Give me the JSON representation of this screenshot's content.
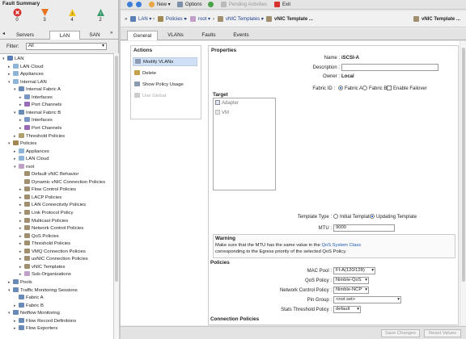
{
  "fault_summary": {
    "title": "Fault Summary",
    "items": [
      {
        "count": "0",
        "icon": "critical-x-icon",
        "color": "#d9302c"
      },
      {
        "count": "3",
        "icon": "major-triangle-icon",
        "color": "#e8731e"
      },
      {
        "count": "4",
        "icon": "minor-triangle-icon",
        "color": "#f2c21b"
      },
      {
        "count": "2",
        "icon": "warning-triangle-icon",
        "color": "#3a9c6a"
      }
    ]
  },
  "left_tabs": [
    "Servers",
    "LAN",
    "SAN"
  ],
  "left_tabs_active": "LAN",
  "filter": {
    "label": "Filter:",
    "value": "All"
  },
  "tree": [
    {
      "label": "LAN",
      "depth": 0,
      "exp": "▾",
      "icon": "#5a7fb5"
    },
    {
      "label": "LAN Cloud",
      "depth": 1,
      "exp": "▸",
      "icon": "#8fb4d9"
    },
    {
      "label": "Appliances",
      "depth": 1,
      "exp": "▸",
      "icon": "#8fb4d9"
    },
    {
      "label": "Internal LAN",
      "depth": 1,
      "exp": "▾",
      "icon": "#8fb4d9"
    },
    {
      "label": "Internal Fabric A",
      "depth": 2,
      "exp": "▾",
      "icon": "#6a8ab8"
    },
    {
      "label": "Interfaces",
      "depth": 3,
      "exp": "▸",
      "icon": "#7a96c4"
    },
    {
      "label": "Port Channels",
      "depth": 3,
      "exp": "▸",
      "icon": "#9a6ab8"
    },
    {
      "label": "Internal Fabric B",
      "depth": 2,
      "exp": "▾",
      "icon": "#6a8ab8"
    },
    {
      "label": "Interfaces",
      "depth": 3,
      "exp": "▸",
      "icon": "#7a96c4"
    },
    {
      "label": "Port Channels",
      "depth": 3,
      "exp": "▸",
      "icon": "#9a6ab8"
    },
    {
      "label": "Threshold Policies",
      "depth": 2,
      "exp": "▸",
      "icon": "#b0a070"
    },
    {
      "label": "Policies",
      "depth": 1,
      "exp": "▾",
      "icon": "#a08850"
    },
    {
      "label": "Appliances",
      "depth": 2,
      "exp": "▸",
      "icon": "#8fb4d9"
    },
    {
      "label": "LAN Cloud",
      "depth": 2,
      "exp": "▸",
      "icon": "#8fb4d9"
    },
    {
      "label": "root",
      "depth": 2,
      "exp": "▾",
      "icon": "#c0a0c8"
    },
    {
      "label": "Default vNIC Behavior",
      "depth": 3,
      "exp": "",
      "icon": "#a09070"
    },
    {
      "label": "Dynamic vNIC Connection Policies",
      "depth": 3,
      "exp": "",
      "icon": "#a09070"
    },
    {
      "label": "Flow Control Policies",
      "depth": 3,
      "exp": "▸",
      "icon": "#a09070"
    },
    {
      "label": "LACP Policies",
      "depth": 3,
      "exp": "▸",
      "icon": "#a09070"
    },
    {
      "label": "LAN Connectivity Policies",
      "depth": 3,
      "exp": "▸",
      "icon": "#a09070"
    },
    {
      "label": "Link Protocol Policy",
      "depth": 3,
      "exp": "▸",
      "icon": "#a09070"
    },
    {
      "label": "Multicast Policies",
      "depth": 3,
      "exp": "▸",
      "icon": "#a09070"
    },
    {
      "label": "Network Control Policies",
      "depth": 3,
      "exp": "▸",
      "icon": "#a09070"
    },
    {
      "label": "QoS Policies",
      "depth": 3,
      "exp": "▸",
      "icon": "#a09070"
    },
    {
      "label": "Threshold Policies",
      "depth": 3,
      "exp": "▸",
      "icon": "#a09070"
    },
    {
      "label": "VMQ Connection Policies",
      "depth": 3,
      "exp": "▸",
      "icon": "#a09070"
    },
    {
      "label": "usNIC Connection Policies",
      "depth": 3,
      "exp": "▸",
      "icon": "#a09070"
    },
    {
      "label": "vNIC Templates",
      "depth": 3,
      "exp": "▸",
      "icon": "#a09070"
    },
    {
      "label": "Sub-Organizations",
      "depth": 3,
      "exp": "▸",
      "icon": "#c0a0c8"
    },
    {
      "label": "Pools",
      "depth": 1,
      "exp": "▸",
      "icon": "#6a8ab8"
    },
    {
      "label": "Traffic Monitoring Sessions",
      "depth": 1,
      "exp": "▾",
      "icon": "#6a8ab8"
    },
    {
      "label": "Fabric A",
      "depth": 2,
      "exp": "",
      "icon": "#6a8ab8"
    },
    {
      "label": "Fabric B",
      "depth": 2,
      "exp": "▸",
      "icon": "#6a8ab8"
    },
    {
      "label": "Netflow Monitoring",
      "depth": 1,
      "exp": "▾",
      "icon": "#6a8ab8"
    },
    {
      "label": "Flow Record Definitions",
      "depth": 2,
      "exp": "▸",
      "icon": "#6a8ab8"
    },
    {
      "label": "Flow Exporters",
      "depth": 2,
      "exp": "▸",
      "icon": "#6a8ab8"
    }
  ],
  "toolbar": {
    "new": "New ▾",
    "options": "Options",
    "pending": "Pending Activities",
    "exit": "Exit"
  },
  "breadcrumb": {
    "lan": "LAN ▾",
    "policies": "Policies ▾",
    "root": "root ▾",
    "vnic_templates": "vNIC Templates ▾",
    "current": "vNIC Template ...",
    "title_right": "vNIC Template ..."
  },
  "main_tabs": [
    "General",
    "VLANs",
    "Faults",
    "Events"
  ],
  "actions": {
    "title": "Actions",
    "items": [
      "Modify VLANs",
      "Delete",
      "Show Policy Usage",
      "Use Global"
    ]
  },
  "properties": {
    "title": "Properties",
    "name_label": "Name :",
    "name_value": "iSCSI-A",
    "description_label": "Description :",
    "description_value": "",
    "owner_label": "Owner :",
    "owner_value": "Local",
    "fabric_label": "Fabric ID :",
    "fabric_a": "Fabric A",
    "fabric_b": "Fabric B",
    "enable_failover": "Enable Failover",
    "target_title": "Target",
    "target_items": [
      "Adapter",
      "VM"
    ],
    "template_type_label": "Template Type :",
    "template_initial": "Initial Template",
    "template_updating": "Updating Template",
    "mtu_label": "MTU :",
    "mtu_value": "9000",
    "warning_title": "Warning",
    "warning_line1_pre": "Make sure that the MTU has the same value in the ",
    "warning_link": "QoS System Class",
    "warning_line2": "corresponding to the Egress priority of the selected QoS Policy.",
    "policies_title": "Policies",
    "mac_pool_label": "MAC Pool :",
    "mac_pool_value": "FI-A(120/128)",
    "qos_label": "QoS Policy :",
    "qos_value": "Nimble-QoS",
    "ncp_label": "Network Control Policy :",
    "ncp_value": "Nimble-NCP",
    "pin_group_label": "Pin Group :",
    "pin_group_value": "<not set>",
    "stats_label": "Stats Threshold Policy :",
    "stats_value": "default",
    "connection_title": "Connection Policies"
  },
  "footer": {
    "save": "Save Changes",
    "reset": "Reset Values"
  }
}
